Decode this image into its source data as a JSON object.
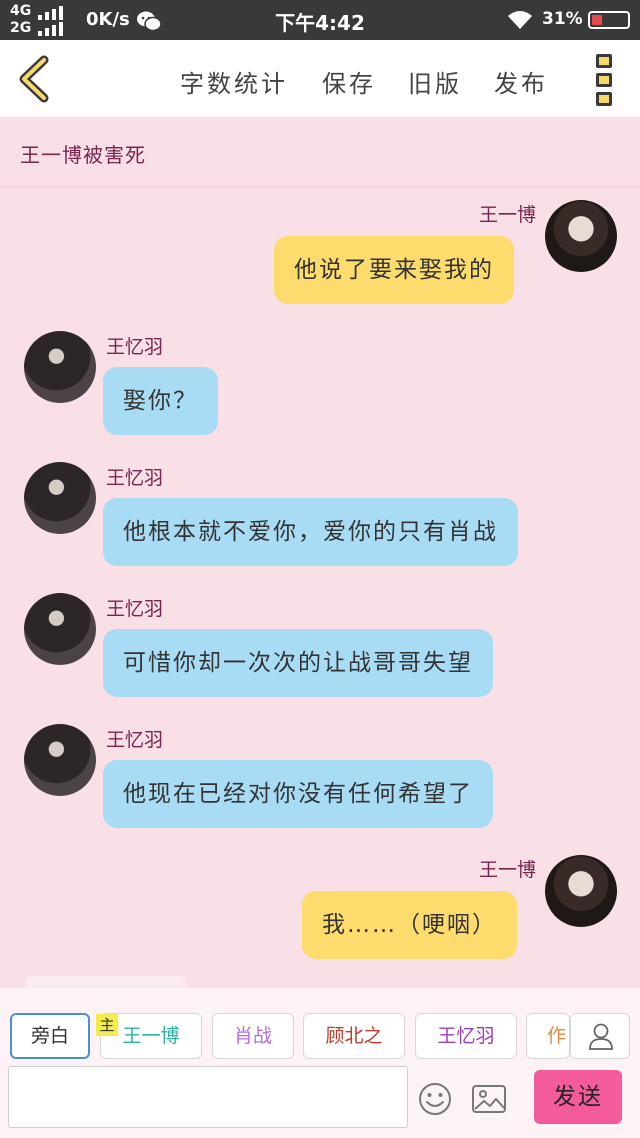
{
  "status_bar": {
    "network_top": "4G",
    "network_bottom": "2G",
    "speed": "0K/s",
    "time": "下午4:42",
    "battery": "31%"
  },
  "toolbar": {
    "items": [
      "字数统计",
      "保存",
      "旧版",
      "发布"
    ]
  },
  "chat": {
    "title": "王一博被害死",
    "messages": [
      {
        "sender": "王一博",
        "text": "他说了要来娶我的",
        "side": "right"
      },
      {
        "sender": "王忆羽",
        "text": "娶你？",
        "side": "left"
      },
      {
        "sender": "王忆羽",
        "text": "他根本就不爱你，爱你的只有肖战",
        "side": "left"
      },
      {
        "sender": "王忆羽",
        "text": "可惜你却一次次的让战哥哥失望",
        "side": "left"
      },
      {
        "sender": "王忆羽",
        "text": "他现在已经对你没有任何希望了",
        "side": "left"
      },
      {
        "sender": "王一博",
        "text": "我……（哽咽）",
        "side": "right"
      }
    ]
  },
  "composer": {
    "roles": [
      {
        "label": "旁白",
        "color": "#333333"
      },
      {
        "label": "王一博",
        "color": "#2bb3a6",
        "badge": "主"
      },
      {
        "label": "肖战",
        "color": "#b66ad8"
      },
      {
        "label": "顾北之",
        "color": "#c0392b"
      },
      {
        "label": "王忆羽",
        "color": "#9b3fb5"
      },
      {
        "label": "作",
        "color": "#e08a3a"
      }
    ],
    "input_value": "",
    "send_label": "发送"
  },
  "colors": {
    "background": "#f9dfe6",
    "bubble_self": "#fddb6d",
    "bubble_other": "#a8dcf5",
    "sender_name": "#7a2551",
    "send_button": "#f45b9b"
  }
}
